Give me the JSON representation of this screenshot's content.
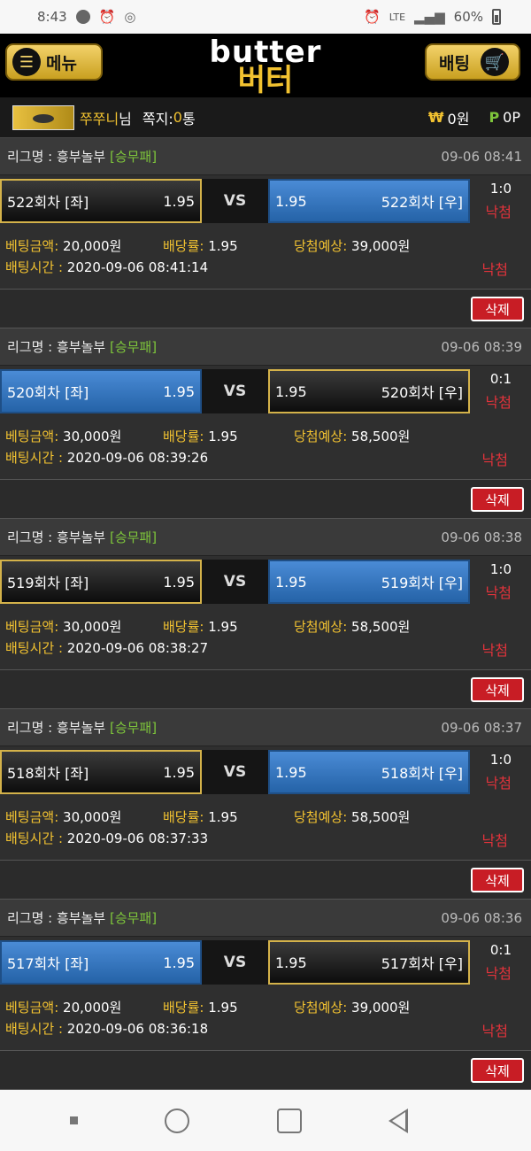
{
  "status_bar": {
    "time": "8:43",
    "network": "LTE",
    "battery": "60%"
  },
  "header": {
    "menu_label": "메뉴",
    "logo_en": "butter",
    "logo_ko": "버터",
    "bet_label": "배팅"
  },
  "user": {
    "name": "쭈쭈니",
    "suffix": "님",
    "mail_label": "쪽지:",
    "mail_count": "0",
    "mail_unit": "통",
    "won_symbol": "₩",
    "won_value": "0원",
    "point_symbol": "P",
    "point_value": "0P"
  },
  "labels": {
    "league_prefix": "리그명 : ",
    "vs": "VS",
    "amount": "베팅금액:",
    "odds": "배당률:",
    "estimate": "당첨예상:",
    "bet_time": "배팅시간 : ",
    "delete": "삭제"
  },
  "bets": [
    {
      "league": "흥부놀부",
      "category": "[승무패]",
      "time": "09-06 08:41",
      "left_team": "522회차 [좌]",
      "left_odds": "1.95",
      "right_team": "522회차 [우]",
      "right_odds": "1.95",
      "selected": "left",
      "score": "1:0",
      "result": "낙첨",
      "amount": "20,000원",
      "odds": "1.95",
      "estimate": "39,000원",
      "bet_time": "2020-09-06 08:41:14",
      "status": "낙첨"
    },
    {
      "league": "흥부놀부",
      "category": "[승무패]",
      "time": "09-06 08:39",
      "left_team": "520회차 [좌]",
      "left_odds": "1.95",
      "right_team": "520회차 [우]",
      "right_odds": "1.95",
      "selected": "right",
      "score": "0:1",
      "result": "낙첨",
      "amount": "30,000원",
      "odds": "1.95",
      "estimate": "58,500원",
      "bet_time": "2020-09-06 08:39:26",
      "status": "낙첨"
    },
    {
      "league": "흥부놀부",
      "category": "[승무패]",
      "time": "09-06 08:38",
      "left_team": "519회차 [좌]",
      "left_odds": "1.95",
      "right_team": "519회차 [우]",
      "right_odds": "1.95",
      "selected": "left",
      "score": "1:0",
      "result": "낙첨",
      "amount": "30,000원",
      "odds": "1.95",
      "estimate": "58,500원",
      "bet_time": "2020-09-06 08:38:27",
      "status": "낙첨"
    },
    {
      "league": "흥부놀부",
      "category": "[승무패]",
      "time": "09-06 08:37",
      "left_team": "518회차 [좌]",
      "left_odds": "1.95",
      "right_team": "518회차 [우]",
      "right_odds": "1.95",
      "selected": "left",
      "score": "1:0",
      "result": "낙첨",
      "amount": "30,000원",
      "odds": "1.95",
      "estimate": "58,500원",
      "bet_time": "2020-09-06 08:37:33",
      "status": "낙첨"
    },
    {
      "league": "흥부놀부",
      "category": "[승무패]",
      "time": "09-06 08:36",
      "left_team": "517회차 [좌]",
      "left_odds": "1.95",
      "right_team": "517회차 [우]",
      "right_odds": "1.95",
      "selected": "right",
      "score": "0:1",
      "result": "낙첨",
      "amount": "20,000원",
      "odds": "1.95",
      "estimate": "39,000원",
      "bet_time": "2020-09-06 08:36:18",
      "status": "낙첨"
    }
  ]
}
